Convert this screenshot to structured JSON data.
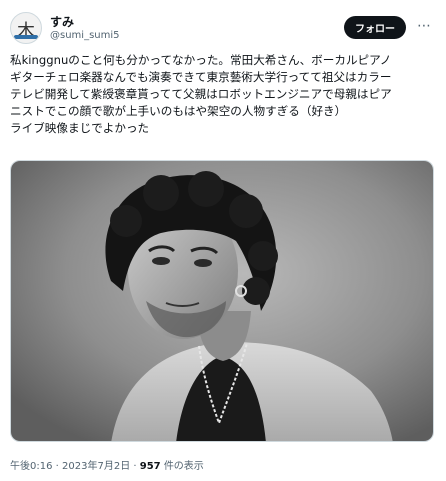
{
  "tweet": {
    "display_name": "すみ",
    "handle": "@sumi_sumi5",
    "follow_label": "フォロー",
    "more_icon": "more-horizontal-icon",
    "text": "私kinggnuのこと何も分かってなかった。常田大希さん、ボーカルピアノ\nギターチェロ楽器なんでも演奏できて東京藝術大学行ってて祖父はカラー\nテレビ開発して紫綬褒章貰ってて父親はロボットエンジニアで母親はピア\nニストでこの顔で歌が上手いのもはや架空の人物すぎる（好き）\nライブ映像まじでよかった",
    "time": "午後0:16",
    "date": "2023年7月2日",
    "views_count": "957",
    "views_label": "件の表示"
  }
}
